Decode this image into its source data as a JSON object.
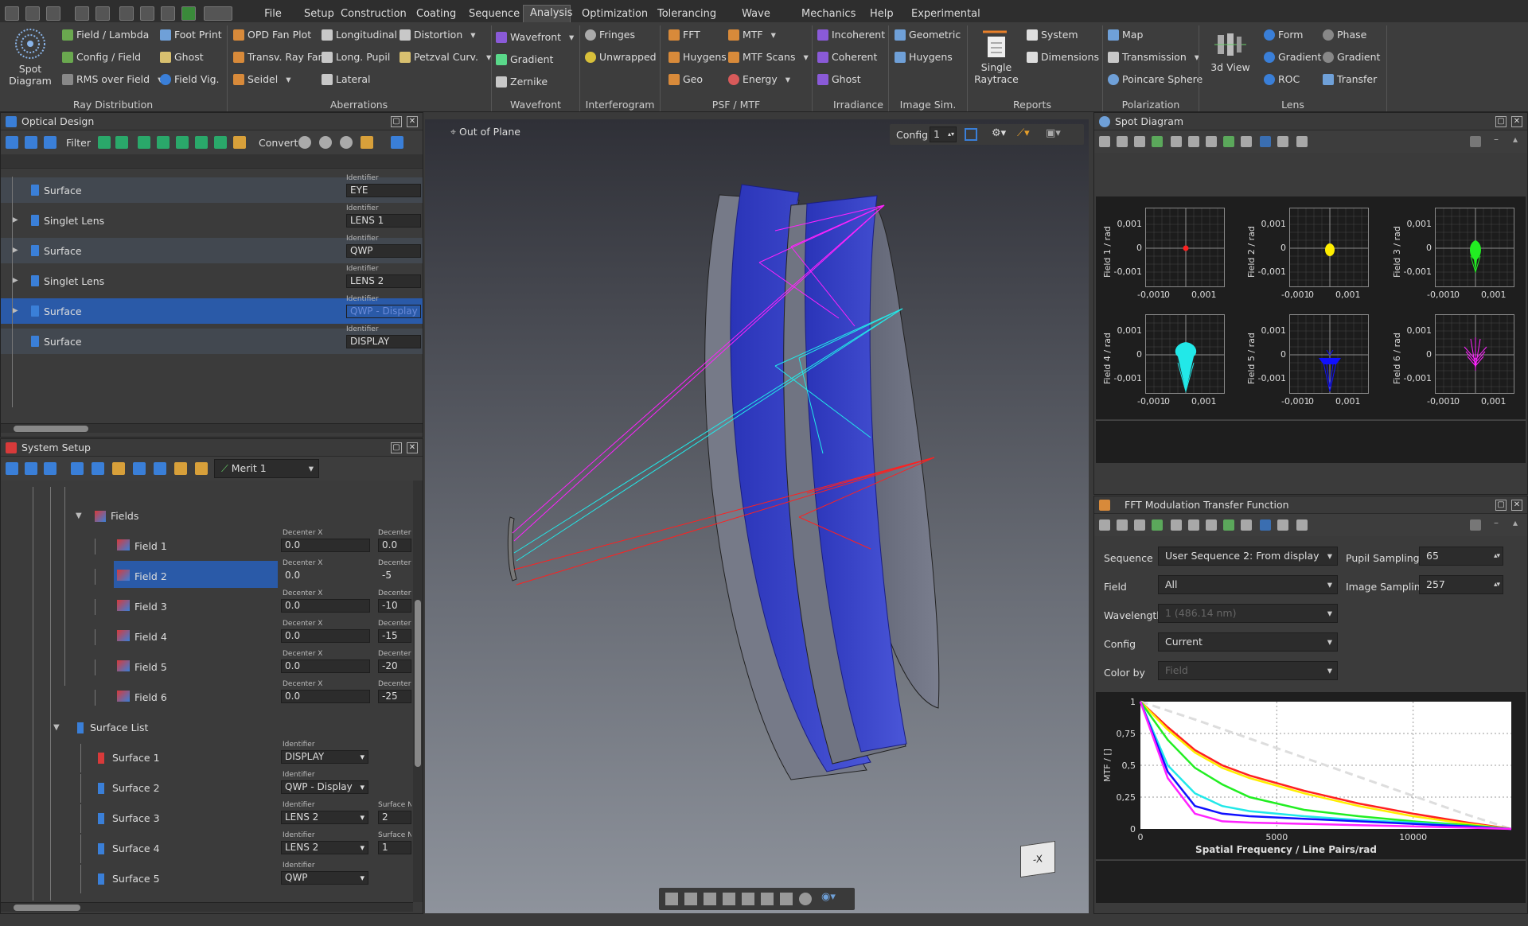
{
  "menu": {
    "tabs": [
      "File",
      "Setup",
      "Construction",
      "Coating",
      "Sequence",
      "Analysis",
      "Optimization",
      "Tolerancing",
      "Wave Optics",
      "Mechanics",
      "Help",
      "Experimental"
    ],
    "active": "Analysis"
  },
  "ribbon": {
    "ray_distribution": {
      "label": "Ray Distribution",
      "big": [
        "Spot",
        "Diagram"
      ],
      "items": [
        "Field / Lambda",
        "Config / Field",
        "RMS over Field",
        "Foot Print",
        "Ghost",
        "Field Vig."
      ]
    },
    "aberrations": {
      "label": "Aberrations",
      "items": [
        "OPD Fan Plot",
        "Transv. Ray Fan",
        "Seidel",
        "Longitudinal",
        "Long. Pupil",
        "Lateral",
        "Distortion",
        "Petzval Curv."
      ]
    },
    "wavefront": {
      "label": "Wavefront",
      "items": [
        "Wavefront",
        "Gradient",
        "Zernike"
      ]
    },
    "interferogram": {
      "label": "Interferogram",
      "items": [
        "Fringes",
        "Unwrapped"
      ]
    },
    "psf_mtf": {
      "label": "PSF / MTF",
      "items": [
        "FFT",
        "Huygens",
        "Geo",
        "MTF",
        "MTF Scans",
        "Energy"
      ]
    },
    "irradiance": {
      "label": "Irradiance",
      "items": [
        "Incoherent",
        "Coherent",
        "Ghost"
      ]
    },
    "image_sim": {
      "label": "Image Sim.",
      "items": [
        "Geometric",
        "Huygens"
      ]
    },
    "reports": {
      "label": "Reports",
      "big": [
        "Single",
        "Raytrace"
      ],
      "items": [
        "System",
        "Dimensions"
      ]
    },
    "polarization": {
      "label": "Polarization",
      "items": [
        "Map",
        "Transmission",
        "Poincare Sphere"
      ]
    },
    "lens": {
      "label": "Lens",
      "big": [
        "3d View"
      ],
      "items": [
        "Form",
        "Gradient",
        "ROC",
        "Phase",
        "Gradient",
        "Transfer"
      ]
    }
  },
  "optical_design": {
    "title": "Optical Design",
    "toolbar": {
      "filter": "Filter",
      "convert": "Convert"
    },
    "id_label": "Identifier",
    "rows": [
      {
        "name": "Surface",
        "id": "EYE"
      },
      {
        "name": "Singlet Lens",
        "id": "LENS 1"
      },
      {
        "name": "Surface",
        "id": "QWP"
      },
      {
        "name": "Singlet Lens",
        "id": "LENS 2"
      },
      {
        "name": "Surface",
        "id": "QWP - Display"
      },
      {
        "name": "Surface",
        "id": "DISPLAY"
      }
    ]
  },
  "system_setup": {
    "title": "System Setup",
    "merit": "Merit 1",
    "fields_label": "Fields",
    "decx_label": "Decenter X",
    "decy_label": "Decenter Y",
    "fields": [
      {
        "name": "Field 1",
        "x": "0.0",
        "y": "0.0"
      },
      {
        "name": "Field 2",
        "x": "0.0",
        "y": "-5"
      },
      {
        "name": "Field 3",
        "x": "0.0",
        "y": "-10"
      },
      {
        "name": "Field 4",
        "x": "0.0",
        "y": "-15"
      },
      {
        "name": "Field 5",
        "x": "0.0",
        "y": "-20"
      },
      {
        "name": "Field 6",
        "x": "0.0",
        "y": "-25"
      }
    ],
    "surface_list_label": "Surface List",
    "id_label": "Identifier",
    "surfnr_label": "Surface Nr",
    "surfaces": [
      {
        "name": "Surface 1",
        "id": "DISPLAY",
        "nr": ""
      },
      {
        "name": "Surface 2",
        "id": "QWP - Display",
        "nr": ""
      },
      {
        "name": "Surface 3",
        "id": "LENS 2",
        "nr": "2"
      },
      {
        "name": "Surface 4",
        "id": "LENS 2",
        "nr": "1"
      },
      {
        "name": "Surface 5",
        "id": "QWP",
        "nr": ""
      }
    ]
  },
  "viewport": {
    "out_of_plane": "Out of Plane",
    "config_label": "Config",
    "config_value": "1",
    "cube_label": "-X"
  },
  "spot_diagram": {
    "title": "Spot Diagram",
    "plots": [
      {
        "ylabel": "Field 1 / rad",
        "color": "#ff2020"
      },
      {
        "ylabel": "Field 2 / rad",
        "color": "#ffee00"
      },
      {
        "ylabel": "Field 3 / rad",
        "color": "#22ee22"
      },
      {
        "ylabel": "Field 4 / rad",
        "color": "#22e8e8"
      },
      {
        "ylabel": "Field 5 / rad",
        "color": "#1010ff"
      },
      {
        "ylabel": "Field 6 / rad",
        "color": "#ff22ff"
      }
    ],
    "yticks": [
      "0,001",
      "0",
      "-0,001"
    ],
    "xticks": [
      "-0,001",
      "0",
      "0,001"
    ]
  },
  "mtf": {
    "title": "FFT Modulation Transfer Function",
    "sequence_label": "Sequence",
    "sequence": "User Sequence 2: From display",
    "field_label": "Field",
    "field": "All",
    "wavelength_label": "Wavelength",
    "wavelength": "1 (486.14 nm)",
    "config_label": "Config",
    "config": "Current",
    "colorby_label": "Color by",
    "colorby": "Field",
    "pupil_label": "Pupil Sampling",
    "pupil": "65",
    "image_label": "Image Sampling",
    "image": "257",
    "xlabel": "Spatial Frequency / Line Pairs/rad",
    "ylabel": "MTF / []",
    "yticks": [
      "1",
      "0,75",
      "0,5",
      "0,25",
      "0"
    ],
    "xticks": [
      "0",
      "5000",
      "10000"
    ]
  },
  "chart_data": {
    "type": "line",
    "title": "",
    "xlabel": "Spatial Frequency / Line Pairs/rad",
    "ylabel": "MTF / []",
    "xlim": [
      0,
      13600
    ],
    "ylim": [
      0,
      1
    ],
    "series": [
      {
        "color": "#dddddd",
        "x": [
          0,
          2000,
          4000,
          6000,
          8000,
          10000,
          12000,
          13600
        ],
        "values": [
          1,
          0.86,
          0.71,
          0.56,
          0.41,
          0.26,
          0.11,
          0
        ]
      },
      {
        "color": "#ff2020",
        "x": [
          0,
          1000,
          2000,
          3000,
          4000,
          6000,
          8000,
          10000,
          12000,
          13600
        ],
        "values": [
          1,
          0.8,
          0.62,
          0.5,
          0.42,
          0.3,
          0.2,
          0.12,
          0.05,
          0
        ]
      },
      {
        "color": "#ffee00",
        "x": [
          0,
          1000,
          2000,
          3000,
          4000,
          6000,
          8000,
          10000,
          12000,
          13600
        ],
        "values": [
          1,
          0.78,
          0.6,
          0.48,
          0.4,
          0.28,
          0.18,
          0.1,
          0.04,
          0
        ]
      },
      {
        "color": "#22ee22",
        "x": [
          0,
          1000,
          2000,
          3000,
          4000,
          6000,
          8000,
          10000,
          12000,
          13600
        ],
        "values": [
          1,
          0.7,
          0.48,
          0.35,
          0.25,
          0.15,
          0.1,
          0.06,
          0.03,
          0
        ]
      },
      {
        "color": "#22e8e8",
        "x": [
          0,
          1000,
          2000,
          3000,
          4000,
          6000,
          8000,
          10000,
          12000,
          13600
        ],
        "values": [
          1,
          0.5,
          0.28,
          0.18,
          0.14,
          0.1,
          0.07,
          0.05,
          0.02,
          0
        ]
      },
      {
        "color": "#1010ff",
        "x": [
          0,
          1000,
          2000,
          3000,
          4000,
          6000,
          8000,
          10000,
          12000,
          13600
        ],
        "values": [
          1,
          0.45,
          0.18,
          0.12,
          0.1,
          0.08,
          0.06,
          0.04,
          0.02,
          0
        ]
      },
      {
        "color": "#ff22ff",
        "x": [
          0,
          1000,
          2000,
          3000,
          4000,
          6000,
          8000,
          10000,
          12000,
          13600
        ],
        "values": [
          1,
          0.4,
          0.12,
          0.06,
          0.05,
          0.04,
          0.03,
          0.02,
          0.01,
          0
        ]
      }
    ]
  }
}
